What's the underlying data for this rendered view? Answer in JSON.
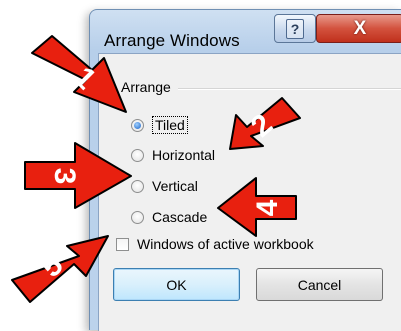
{
  "dialog": {
    "title": "Arrange Windows",
    "help_glyph": "?",
    "close_glyph": "X"
  },
  "arrange_group": {
    "label": "Arrange",
    "options": [
      {
        "label": "Tiled",
        "selected": true
      },
      {
        "label": "Horizontal",
        "selected": false
      },
      {
        "label": "Vertical",
        "selected": false
      },
      {
        "label": "Cascade",
        "selected": false
      }
    ]
  },
  "active_workbook_checkbox": {
    "label": "Windows of active workbook",
    "checked": false
  },
  "buttons": {
    "ok": "OK",
    "cancel": "Cancel"
  },
  "annotations": [
    "1",
    "2",
    "3",
    "4",
    "5"
  ],
  "colors": {
    "arrow_fill": "#e8200f",
    "arrow_outline": "#000000",
    "radio_selected": "#1b63c6",
    "close_button": "#c7412e",
    "ok_border": "#3c7fb1"
  }
}
